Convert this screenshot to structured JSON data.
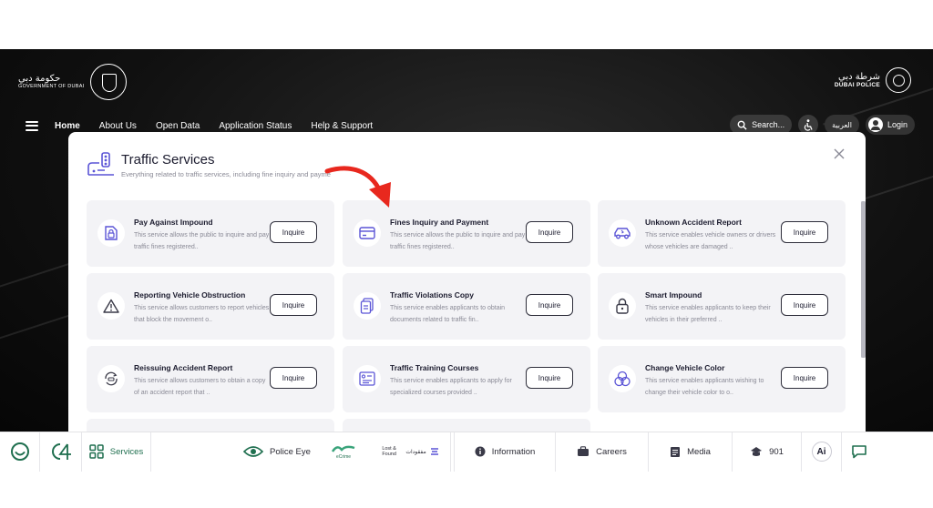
{
  "header": {
    "gov_logo_ar": "حكومة دبي",
    "gov_logo_en": "GOVERNMENT OF DUBAI",
    "police_logo_ar": "شرطة دبي",
    "police_logo_en": "DUBAI POLICE"
  },
  "nav": {
    "items": [
      {
        "label": "Home",
        "active": true
      },
      {
        "label": "About Us"
      },
      {
        "label": "Open Data"
      },
      {
        "label": "Application Status"
      },
      {
        "label": "Help & Support"
      }
    ],
    "search_label": "Search...",
    "language_label": "العربية",
    "login_label": "Login"
  },
  "modal": {
    "title": "Traffic Services",
    "subtitle": "Everything related to traffic services, including fine inquiry and payme",
    "cards": [
      {
        "title": "Pay Against Impound",
        "desc": "This service allows the public to inquire and pay traffic fines registered..",
        "button": "Inquire",
        "icon": "impound-lock-icon"
      },
      {
        "title": "Fines Inquiry and Payment",
        "desc": "This service allows the public to inquire and pay traffic fines registered..",
        "button": "Inquire",
        "icon": "credit-card-icon"
      },
      {
        "title": "Unknown Accident Report",
        "desc": "This service enables vehicle owners or drivers whose vehicles are damaged ..",
        "button": "Inquire",
        "icon": "damaged-car-icon"
      },
      {
        "title": "Reporting Vehicle Obstruction",
        "desc": "This service allows customers to report vehicles that block the movement o..",
        "button": "Inquire",
        "icon": "warning-triangle-icon"
      },
      {
        "title": "Traffic Violations Copy",
        "desc": "This service enables applicants to obtain documents related to traffic fin..",
        "button": "Inquire",
        "icon": "documents-copy-icon"
      },
      {
        "title": "Smart Impound",
        "desc": "This service enables applicants to keep their vehicles in their preferred ..",
        "button": "Inquire",
        "icon": "padlock-icon"
      },
      {
        "title": "Reissuing Accident Report",
        "desc": "This service allows customers to obtain a copy of an accident report that ..",
        "button": "Inquire",
        "icon": "car-refresh-icon"
      },
      {
        "title": "Traffic Training Courses",
        "desc": "This service enables applicants to apply for specialized courses provided ..",
        "button": "Inquire",
        "icon": "training-board-icon"
      },
      {
        "title": "Change Vehicle Color",
        "desc": "This service enables applicants wishing to change their vehicle color to o..",
        "button": "Inquire",
        "icon": "color-circles-icon"
      }
    ]
  },
  "bottombar": {
    "services": "Services",
    "police_eye": "Police Eye",
    "ecrime": "eCrime",
    "lost_found_en": "Lost & Found",
    "lost_found_ar": "مفقودات",
    "information": "Information",
    "careers": "Careers",
    "media": "Media",
    "hotline": "901",
    "ai": "Ai"
  },
  "colors": {
    "accent_purple": "#5a54d6",
    "brand_green": "#1f6f4f",
    "arrow_red": "#e8281e",
    "backdrop": "#111111"
  }
}
